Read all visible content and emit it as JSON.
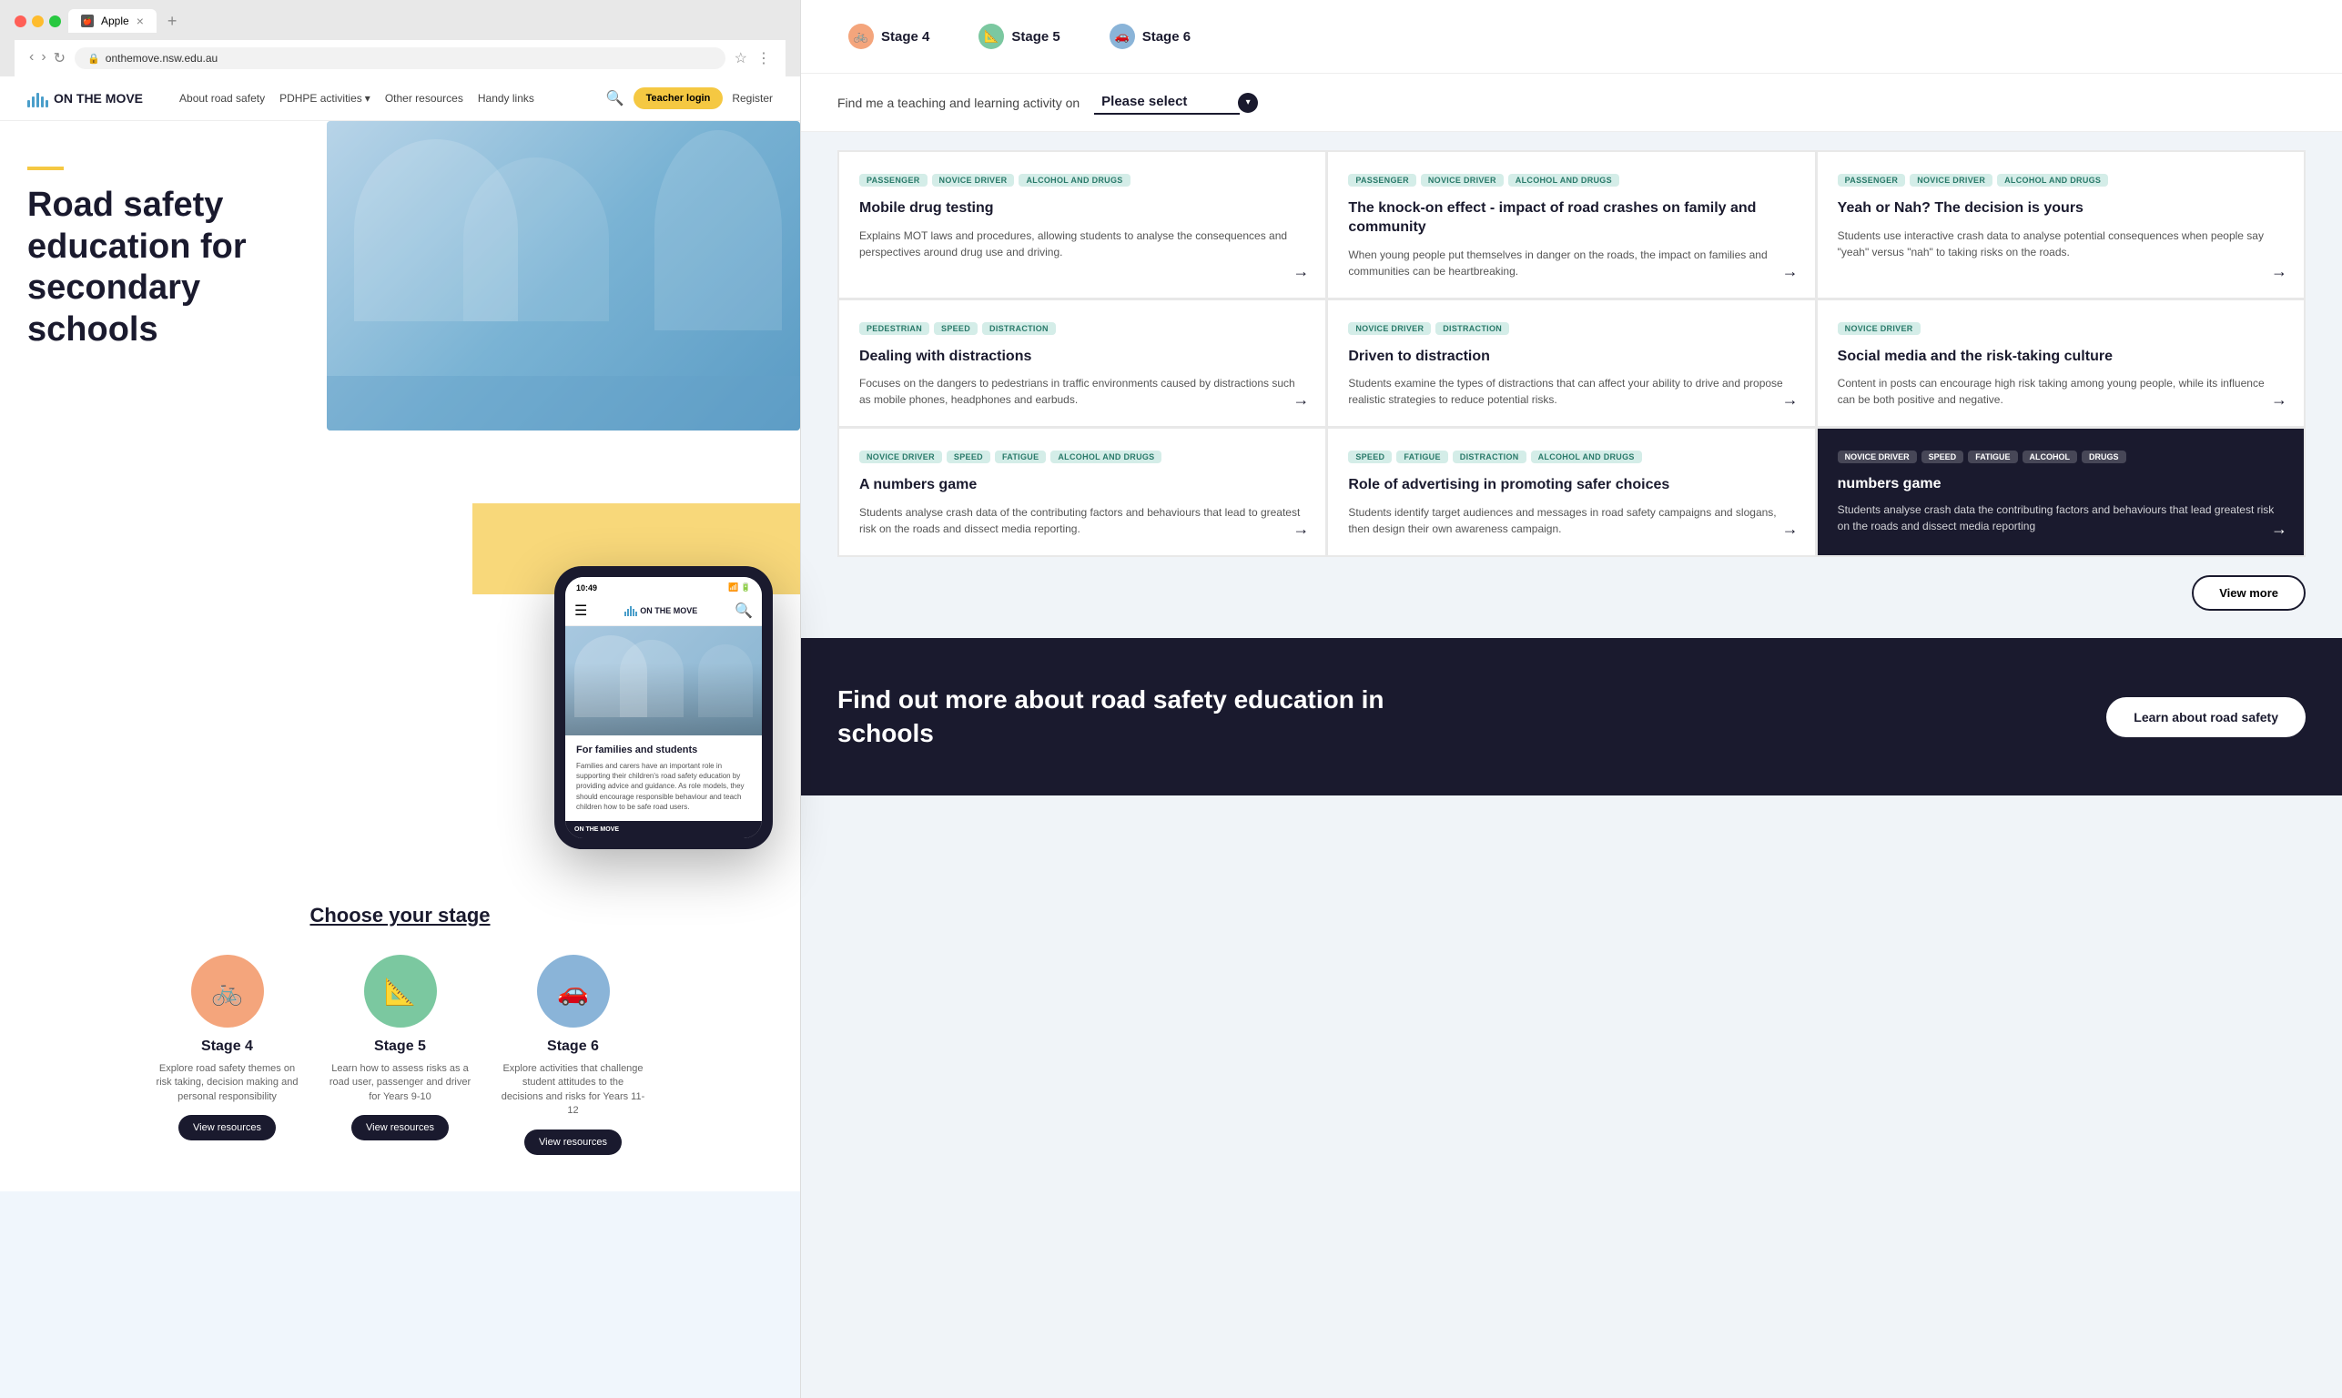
{
  "browser": {
    "title": "Apple",
    "url": "onthemove.nsw.edu.au",
    "tab_close": "×",
    "tab_add": "+"
  },
  "nav": {
    "logo": "ON THE MOVE",
    "links": [
      {
        "label": "About road safety",
        "dropdown": false
      },
      {
        "label": "PDHPE activities",
        "dropdown": true
      },
      {
        "label": "Other resources",
        "dropdown": false
      },
      {
        "label": "Handy links",
        "dropdown": false
      }
    ],
    "teacher_login": "Teacher login",
    "register": "Register"
  },
  "hero": {
    "title": "Road safety education for secondary schools",
    "accent_color": "#f5c842"
  },
  "phone": {
    "time": "10:49",
    "logo": "ON THE MOVE",
    "for_families": "For families and students",
    "description": "Families and carers have an important role in supporting their children's road safety education by providing advice and guidance. As role models, they should encourage responsible behaviour and teach children how to be safe road users."
  },
  "choose_stage": {
    "title": "Choose your stage",
    "stages": [
      {
        "name": "Stage 4",
        "icon": "🚲",
        "color": "#f4a57c",
        "desc": "Explore road safety themes on risk taking, decision making and personal responsibility",
        "btn": "View resources"
      },
      {
        "name": "Stage 5",
        "icon": "📐",
        "color": "#7bc8a0",
        "desc": "Learn how to assess risks as a road user, passenger and driver for Years 9-10",
        "btn": "View resources"
      },
      {
        "name": "Stage 6",
        "icon": "🚗",
        "color": "#8ab4d8",
        "desc": "Explore activities that challenge student attitudes to the decisions and risks for Years 11-12",
        "btn": "View resources"
      }
    ]
  },
  "right_panel": {
    "stage_tabs": [
      {
        "label": "Stage 4",
        "icon": "🚲",
        "icon_bg": "#f4a57c"
      },
      {
        "label": "Stage 5",
        "icon": "📐",
        "icon_bg": "#7bc8a0"
      },
      {
        "label": "Stage 6",
        "icon": "🚗",
        "icon_bg": "#8ab4d8"
      }
    ],
    "filter": {
      "label": "Find me a teaching and learning activity on",
      "placeholder": "Please select"
    },
    "cards": [
      {
        "tags": [
          "PASSENGER",
          "NOVICE DRIVER",
          "ALCOHOL AND DRUGS"
        ],
        "title": "Mobile drug testing",
        "desc": "Explains MOT laws and procedures, allowing students to analyse the consequences and perspectives around drug use and driving."
      },
      {
        "tags": [
          "PASSENGER",
          "NOVICE DRIVER",
          "ALCOHOL AND DRUGS"
        ],
        "title": "The knock-on effect - impact of road crashes on family and community",
        "desc": "When young people put themselves in danger on the roads, the impact on families and communities can be heartbreaking."
      },
      {
        "tags": [
          "PASSENGER",
          "NOVICE DRIVER",
          "ALCOHOL AND DRUGS"
        ],
        "title": "Yeah or Nah? The decision is yours",
        "desc": "Students use interactive crash data to analyse potential consequences when people say \"yeah\" versus \"nah\" to taking risks on the roads."
      },
      {
        "tags": [
          "PEDESTRIAN",
          "SPEED",
          "DISTRACTION"
        ],
        "title": "Dealing with distractions",
        "desc": "Focuses on the dangers to pedestrians in traffic environments caused by distractions such as mobile phones, headphones and earbuds."
      },
      {
        "tags": [
          "NOVICE DRIVER",
          "DISTRACTION"
        ],
        "title": "Driven to distraction",
        "desc": "Students examine the types of distractions that can affect your ability to drive and propose realistic strategies to reduce potential risks."
      },
      {
        "tags": [
          "NOVICE DRIVER"
        ],
        "title": "Social media and the risk-taking culture",
        "desc": "Content in posts can encourage high risk taking among young people, while its influence can be both positive and negative."
      },
      {
        "tags": [
          "NOVICE DRIVER",
          "SPEED",
          "FATIGUE",
          "ALCOHOL AND DRUGS"
        ],
        "title": "A numbers game",
        "desc": "Students analyse crash data of the contributing factors and behaviours that lead to greatest risk on the roads and dissect media reporting."
      },
      {
        "tags": [
          "SPEED",
          "FATIGUE",
          "DISTRACTION",
          "ALCOHOL AND DRUGS"
        ],
        "title": "Role of advertising in promoting safer choices",
        "desc": "Students identify target audiences and messages in road safety campaigns and slogans, then design their own awareness campaign."
      }
    ],
    "numbers_game_card": {
      "tags": [
        "NOvIce DRIVER",
        "SPEED",
        "Fatigue",
        "ALCOHOL",
        "drugs"
      ],
      "title": "numbers game",
      "desc": "Students analyse crash data the contributing factors and behaviours that lead greatest risk on the roads and dissect media reporting"
    },
    "view_more": "View more",
    "bottom_text": "Find out more about road safety education in schools",
    "learn_btn": "Learn about road safety"
  }
}
